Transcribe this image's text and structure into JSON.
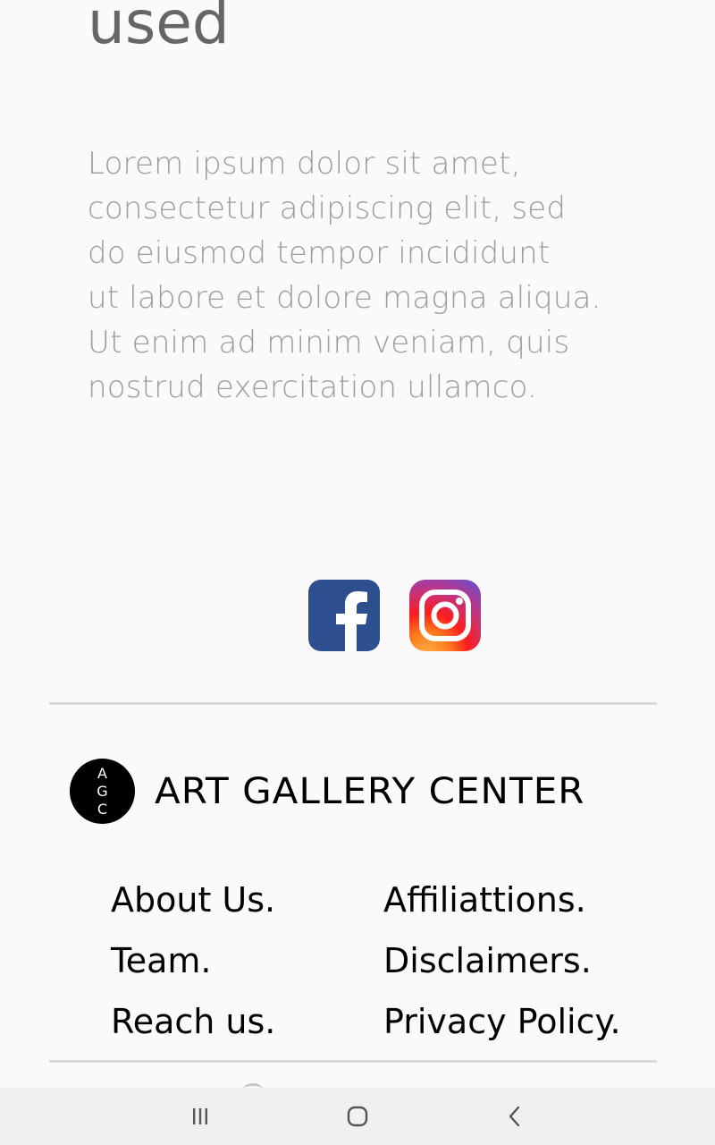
{
  "heading": {
    "text": "used"
  },
  "paragraph": {
    "lines": [
      "Lorem ipsum dolor sit amet,",
      "consectetur adipiscing elit, sed",
      "do eiusmod tempor incididunt",
      "ut labore et dolore magna aliqua.",
      "Ut enim ad minim veniam, quis",
      "nostrud exercitation ullamco."
    ]
  },
  "social": {
    "facebook_icon": "facebook-icon",
    "instagram_icon": "instagram-icon",
    "facebook_color": "#2d4e8f",
    "instagram_colors": [
      "#5b51d8",
      "#c13584",
      "#fd1d1d",
      "#fcaf45"
    ]
  },
  "brand": {
    "logo_letters": [
      "A",
      "G",
      "C"
    ],
    "name": "ART GALLERY CENTER"
  },
  "footer": {
    "left_links": [
      "About Us.",
      "Team.",
      "Reach us."
    ],
    "right_links": [
      "Affiliattions.",
      "Disclaimers.",
      "Privacy Policy."
    ]
  },
  "system_nav": {
    "recents_icon": "recents-icon",
    "home_icon": "home-icon",
    "back_icon": "back-icon"
  }
}
